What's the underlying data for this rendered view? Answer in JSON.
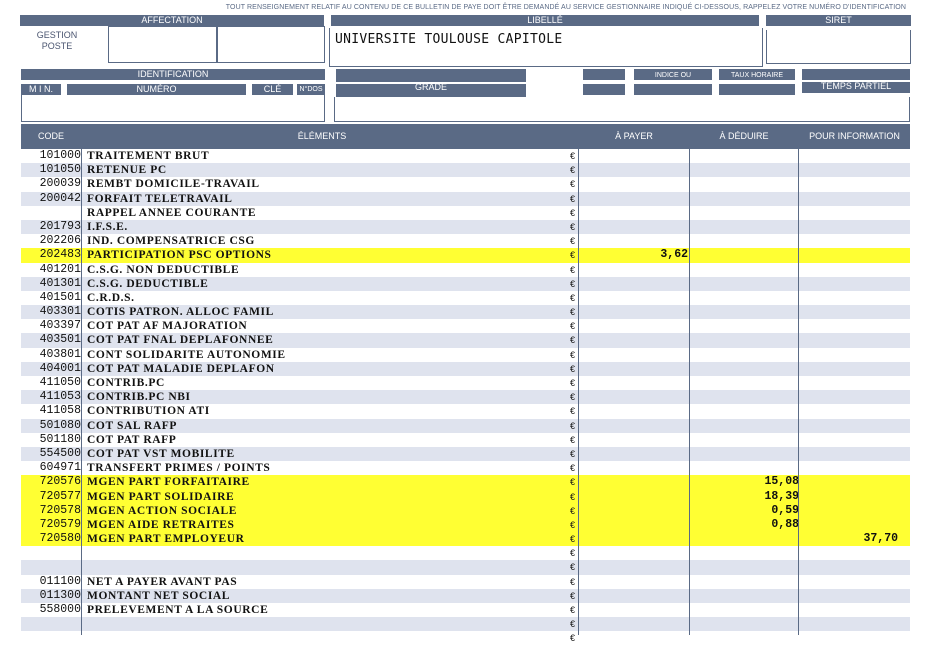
{
  "notice": "TOUT RENSEIGNEMENT RELATIF AU CONTENU DE CE BULLETIN DE PAYE DOIT ÊTRE DEMANDÉ AU SERVICE GESTIONNAIRE INDIQUÉ CI-DESSOUS, RAPPELEZ VOTRE NUMÉRO D'IDENTIFICATION",
  "header": {
    "affectation": "AFFECTATION",
    "gestion_poste": "GESTION\nPOSTE",
    "libelle": "LIBELLÉ",
    "libelle_value": "UNIVERSITE TOULOUSE CAPITOLE",
    "siret": "SIRET",
    "identification": "IDENTIFICATION",
    "min": "M I N.",
    "numero": "NUMÉRO",
    "cle": "CLÉ",
    "ndos": "N°DOS",
    "grade": "GRADE",
    "indice": "INDICE OU",
    "taux_horaire": "TAUX HORAIRE",
    "temps_partiel": "TEMPS PARTIEL"
  },
  "table": {
    "columns": {
      "code": "CODE",
      "elements": "ÉLÉMENTS",
      "a_payer": "À PAYER",
      "a_deduire": "À DÉDUIRE",
      "pour_information": "POUR INFORMATION"
    },
    "currency": "€",
    "rows": [
      {
        "code": "101000",
        "label": "TRAITEMENT BRUT",
        "pay": "",
        "ded": "",
        "info": "",
        "hl": false
      },
      {
        "code": "101050",
        "label": "RETENUE PC",
        "pay": "",
        "ded": "",
        "info": "",
        "hl": false
      },
      {
        "code": "200039",
        "label": "REMBT DOMICILE-TRAVAIL",
        "pay": "",
        "ded": "",
        "info": "",
        "hl": false
      },
      {
        "code": "200042",
        "label": "FORFAIT TELETRAVAIL",
        "pay": "",
        "ded": "",
        "info": "",
        "hl": false
      },
      {
        "code": "",
        "label": "RAPPEL ANNEE COURANTE",
        "pay": "",
        "ded": "",
        "info": "",
        "hl": false
      },
      {
        "code": "201793",
        "label": "I.F.S.E.",
        "pay": "",
        "ded": "",
        "info": "",
        "hl": false
      },
      {
        "code": "202206",
        "label": "IND. COMPENSATRICE CSG",
        "pay": "",
        "ded": "",
        "info": "",
        "hl": false
      },
      {
        "code": "202483",
        "label": "PARTICIPATION PSC OPTIONS",
        "pay": "3,62",
        "ded": "",
        "info": "",
        "hl": true
      },
      {
        "code": "401201",
        "label": "C.S.G. NON DEDUCTIBLE",
        "pay": "",
        "ded": "",
        "info": "",
        "hl": false
      },
      {
        "code": "401301",
        "label": "C.S.G. DEDUCTIBLE",
        "pay": "",
        "ded": "",
        "info": "",
        "hl": false
      },
      {
        "code": "401501",
        "label": "C.R.D.S.",
        "pay": "",
        "ded": "",
        "info": "",
        "hl": false
      },
      {
        "code": "403301",
        "label": "COTIS PATRON. ALLOC FAMIL",
        "pay": "",
        "ded": "",
        "info": "",
        "hl": false
      },
      {
        "code": "403397",
        "label": "COT PAT AF MAJORATION",
        "pay": "",
        "ded": "",
        "info": "",
        "hl": false
      },
      {
        "code": "403501",
        "label": "COT PAT FNAL DEPLAFONNEE",
        "pay": "",
        "ded": "",
        "info": "",
        "hl": false
      },
      {
        "code": "403801",
        "label": "CONT SOLIDARITE AUTONOMIE",
        "pay": "",
        "ded": "",
        "info": "",
        "hl": false
      },
      {
        "code": "404001",
        "label": "COT PAT MALADIE DEPLAFON",
        "pay": "",
        "ded": "",
        "info": "",
        "hl": false
      },
      {
        "code": "411050",
        "label": "CONTRIB.PC",
        "pay": "",
        "ded": "",
        "info": "",
        "hl": false
      },
      {
        "code": "411053",
        "label": "CONTRIB.PC NBI",
        "pay": "",
        "ded": "",
        "info": "",
        "hl": false
      },
      {
        "code": "411058",
        "label": "CONTRIBUTION ATI",
        "pay": "",
        "ded": "",
        "info": "",
        "hl": false
      },
      {
        "code": "501080",
        "label": "COT SAL RAFP",
        "pay": "",
        "ded": "",
        "info": "",
        "hl": false
      },
      {
        "code": "501180",
        "label": "COT PAT RAFP",
        "pay": "",
        "ded": "",
        "info": "",
        "hl": false
      },
      {
        "code": "554500",
        "label": "COT PAT VST MOBILITE",
        "pay": "",
        "ded": "",
        "info": "",
        "hl": false
      },
      {
        "code": "604971",
        "label": "TRANSFERT PRIMES / POINTS",
        "pay": "",
        "ded": "",
        "info": "",
        "hl": false
      },
      {
        "code": "720576",
        "label": "MGEN PART FORFAITAIRE",
        "pay": "",
        "ded": "15,08",
        "info": "",
        "hl": true
      },
      {
        "code": "720577",
        "label": "MGEN PART SOLIDAIRE",
        "pay": "",
        "ded": "18,39",
        "info": "",
        "hl": true
      },
      {
        "code": "720578",
        "label": "MGEN ACTION SOCIALE",
        "pay": "",
        "ded": "0,59",
        "info": "",
        "hl": true
      },
      {
        "code": "720579",
        "label": "MGEN AIDE RETRAITES",
        "pay": "",
        "ded": "0,88",
        "info": "",
        "hl": true
      },
      {
        "code": "720580",
        "label": "MGEN PART EMPLOYEUR",
        "pay": "",
        "ded": "",
        "info": "37,70",
        "hl": true
      },
      {
        "code": "",
        "label": "",
        "pay": "",
        "ded": "",
        "info": "",
        "hl": false
      },
      {
        "code": "",
        "label": "",
        "pay": "",
        "ded": "",
        "info": "",
        "hl": false
      },
      {
        "code": "011100",
        "label": "NET A PAYER AVANT PAS",
        "pay": "",
        "ded": "",
        "info": "",
        "hl": false
      },
      {
        "code": "011300",
        "label": "MONTANT NET SOCIAL",
        "pay": "",
        "ded": "",
        "info": "",
        "hl": false
      },
      {
        "code": "558000",
        "label": "PRELEVEMENT A LA SOURCE",
        "pay": "",
        "ded": "",
        "info": "",
        "hl": false
      },
      {
        "code": "",
        "label": "",
        "pay": "",
        "ded": "",
        "info": "",
        "hl": false
      },
      {
        "code": "",
        "label": "",
        "pay": "",
        "ded": "",
        "info": "",
        "hl": false
      }
    ]
  }
}
